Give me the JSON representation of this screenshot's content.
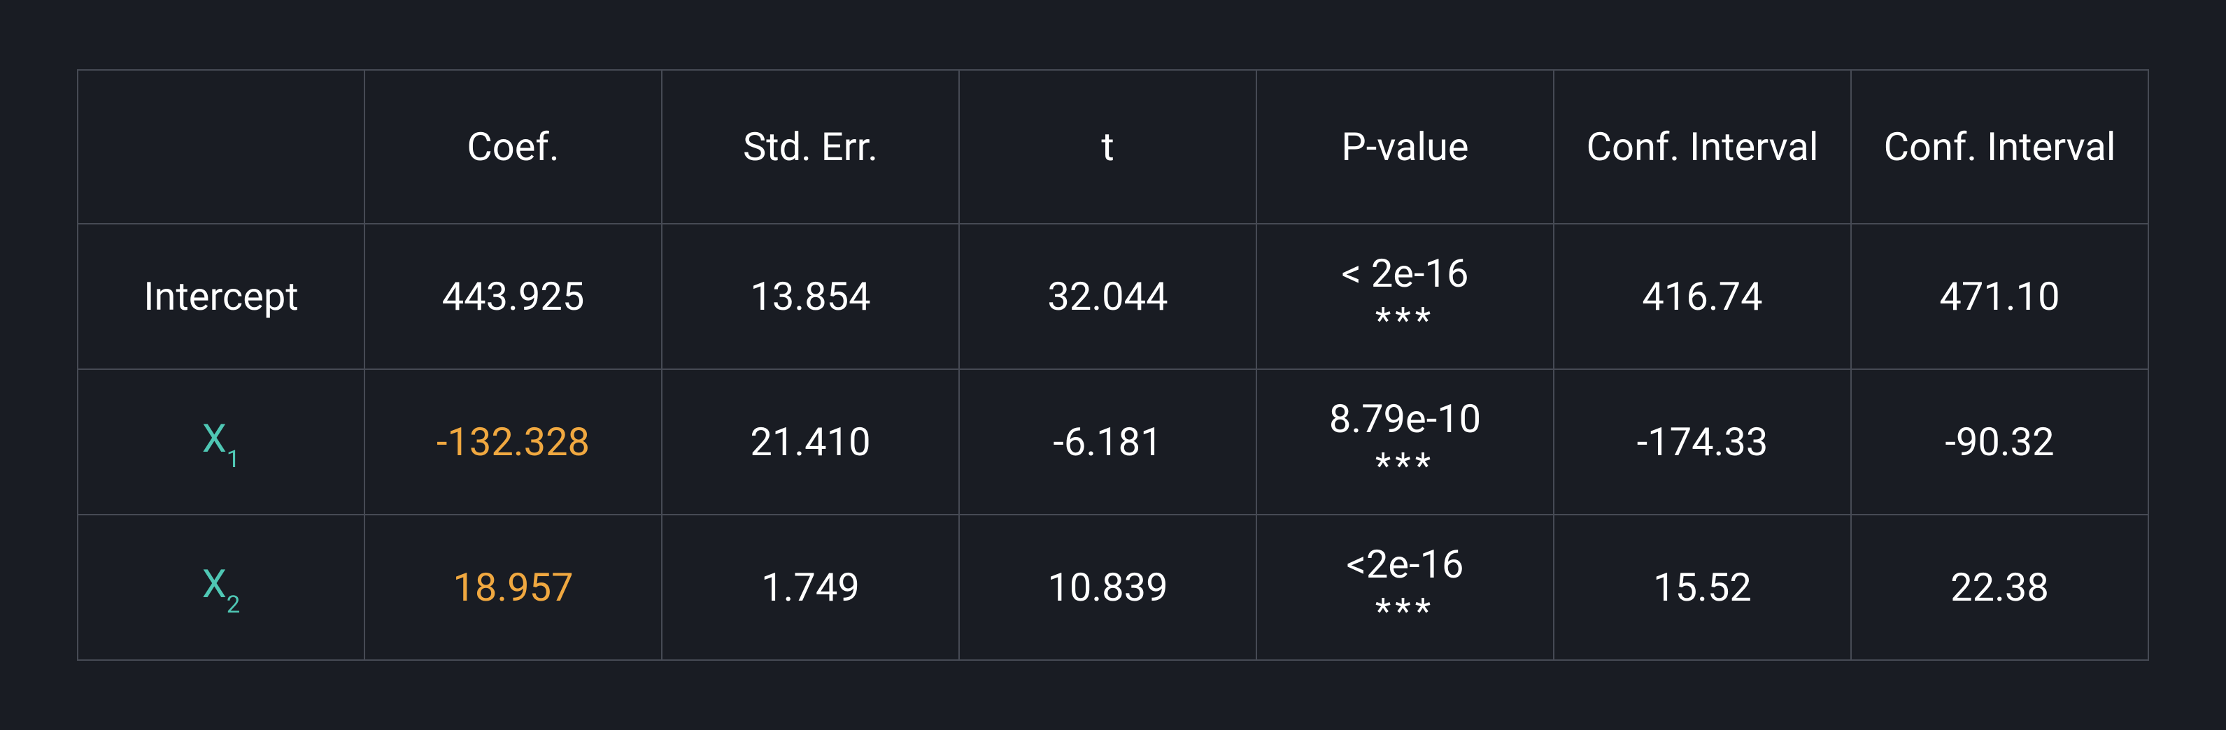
{
  "chart_data": {
    "type": "table",
    "title": "",
    "columns": [
      "",
      "Coef.",
      "Std. Err.",
      "t",
      "P-value",
      "Conf. Interval",
      "Conf. Interval"
    ],
    "rows": [
      {
        "label": "Intercept",
        "coef": 443.925,
        "se": 13.854,
        "t": 32.044,
        "p": "< 2e-16",
        "sig": "***",
        "ci_low": 416.74,
        "ci_high": 471.1
      },
      {
        "label": "X1",
        "coef": -132.328,
        "se": 21.41,
        "t": -6.181,
        "p": "8.79e-10",
        "sig": "***",
        "ci_low": -174.33,
        "ci_high": -90.32
      },
      {
        "label": "X2",
        "coef": 18.957,
        "se": 1.749,
        "t": 10.839,
        "p": "<2e-16",
        "sig": "***",
        "ci_low": 15.52,
        "ci_high": 22.38
      }
    ]
  },
  "headers": {
    "rowhead": "",
    "coef": "Coef.",
    "se": "Std. Err.",
    "t": "t",
    "p": "P-value",
    "ci1": "Conf. Interval",
    "ci2": "Conf. Interval"
  },
  "rows": {
    "intercept": {
      "label": "Intercept",
      "coef": "443.925",
      "se": "13.854",
      "t": "32.044",
      "p_line": "< 2e-16",
      "p_stars": "***",
      "ci_low": "416.74",
      "ci_high": "471.10"
    },
    "x1": {
      "label_base": "X",
      "label_sub": "1",
      "coef": "-132.328",
      "se": "21.410",
      "t": "-6.181",
      "p_line": "8.79e-10",
      "p_stars": "***",
      "ci_low": "-174.33",
      "ci_high": "-90.32"
    },
    "x2": {
      "label_base": "X",
      "label_sub": "2",
      "coef": "18.957",
      "se": "1.749",
      "t": "10.839",
      "p_line": "<2e-16",
      "p_stars": "***",
      "ci_low": "15.52",
      "ci_high": "22.38"
    }
  }
}
